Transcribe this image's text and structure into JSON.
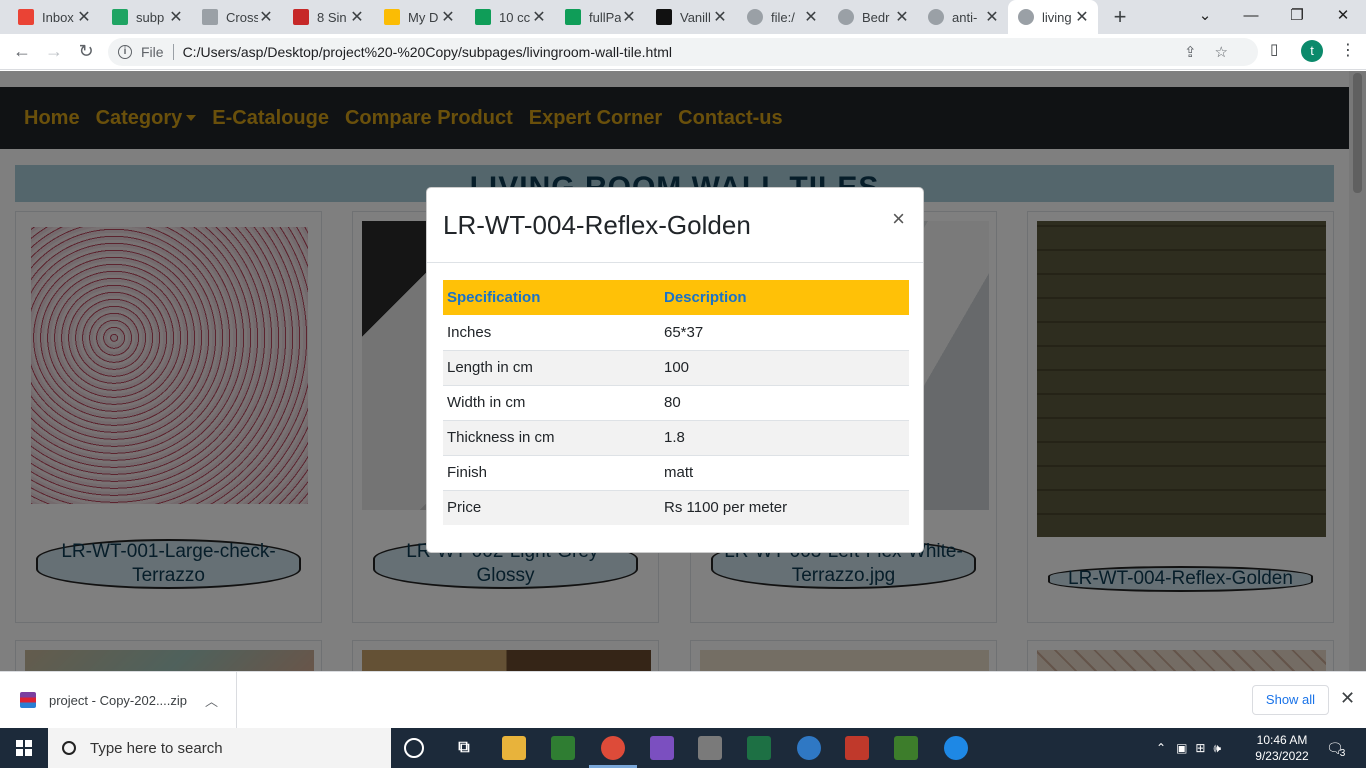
{
  "browser": {
    "tabs": [
      {
        "title": "Inbox",
        "icon": "gmail-icon",
        "color": "#ea4335"
      },
      {
        "title": "subp",
        "icon": "drive-icon",
        "color": "#1fa463"
      },
      {
        "title": "Cross",
        "icon": "css-icon",
        "color": "#9aa0a6"
      },
      {
        "title": "8 Sin",
        "icon": "w-logo-icon",
        "color": "#c62828"
      },
      {
        "title": "My D",
        "icon": "drive-icon",
        "color": "#fbbc04"
      },
      {
        "title": "10 cc",
        "icon": "sheets-icon",
        "color": "#0f9d58"
      },
      {
        "title": "fullPa",
        "icon": "sheets-icon",
        "color": "#0f9d58"
      },
      {
        "title": "Vanill",
        "icon": "codepen-icon",
        "color": "#111111"
      },
      {
        "title": "file:/",
        "icon": "globe-icon",
        "color": "#5f6368"
      },
      {
        "title": "Bedr",
        "icon": "globe-icon",
        "color": "#5f6368"
      },
      {
        "title": "anti-",
        "icon": "globe-icon",
        "color": "#5f6368"
      },
      {
        "title": "living",
        "icon": "globe-icon",
        "color": "#5f6368",
        "active": true
      }
    ],
    "new_tab": "+",
    "address": {
      "scheme_label": "File",
      "url": "C:/Users/asp/Desktop/project%20-%20Copy/subpages/livingroom-wall-tile.html"
    },
    "profile_initial": "t"
  },
  "site": {
    "nav": [
      {
        "label": "Home"
      },
      {
        "label": "Category",
        "dropdown": true
      },
      {
        "label": "E-Catalouge"
      },
      {
        "label": "Compare Product"
      },
      {
        "label": "Expert Corner"
      },
      {
        "label": "Contact-us"
      }
    ],
    "page_heading": "LIVING ROOM WALL TILES",
    "cards": [
      {
        "label_line1": "LR-WT-001-Large-check-",
        "label_line2": "Terrazzo"
      },
      {
        "label_line1": "LR-WT-002-Light-Grey-",
        "label_line2": "Glossy"
      },
      {
        "label_line1": "LR-WT-003-Left-Flex-White-",
        "label_line2": "Terrazzo.jpg"
      },
      {
        "label_line1": "LR-WT-004-Reflex-Golden",
        "label_line2": ""
      }
    ]
  },
  "modal": {
    "title": "LR-WT-004-Reflex-Golden",
    "close": "×",
    "headers": [
      "Specification",
      "Description"
    ],
    "rows": [
      [
        "Inches",
        "65*37"
      ],
      [
        "Length in cm",
        "100"
      ],
      [
        "Width in cm",
        "80"
      ],
      [
        "Thickness in cm",
        "1.8"
      ],
      [
        "Finish",
        "matt"
      ],
      [
        "Price",
        "Rs 1100 per meter"
      ]
    ]
  },
  "downloads": {
    "file_name": "project - Copy-202....zip",
    "show_all": "Show all"
  },
  "taskbar": {
    "search_hint": "Type here to search",
    "time": "10:46 AM",
    "date": "9/23/2022",
    "notification_count": "3"
  }
}
